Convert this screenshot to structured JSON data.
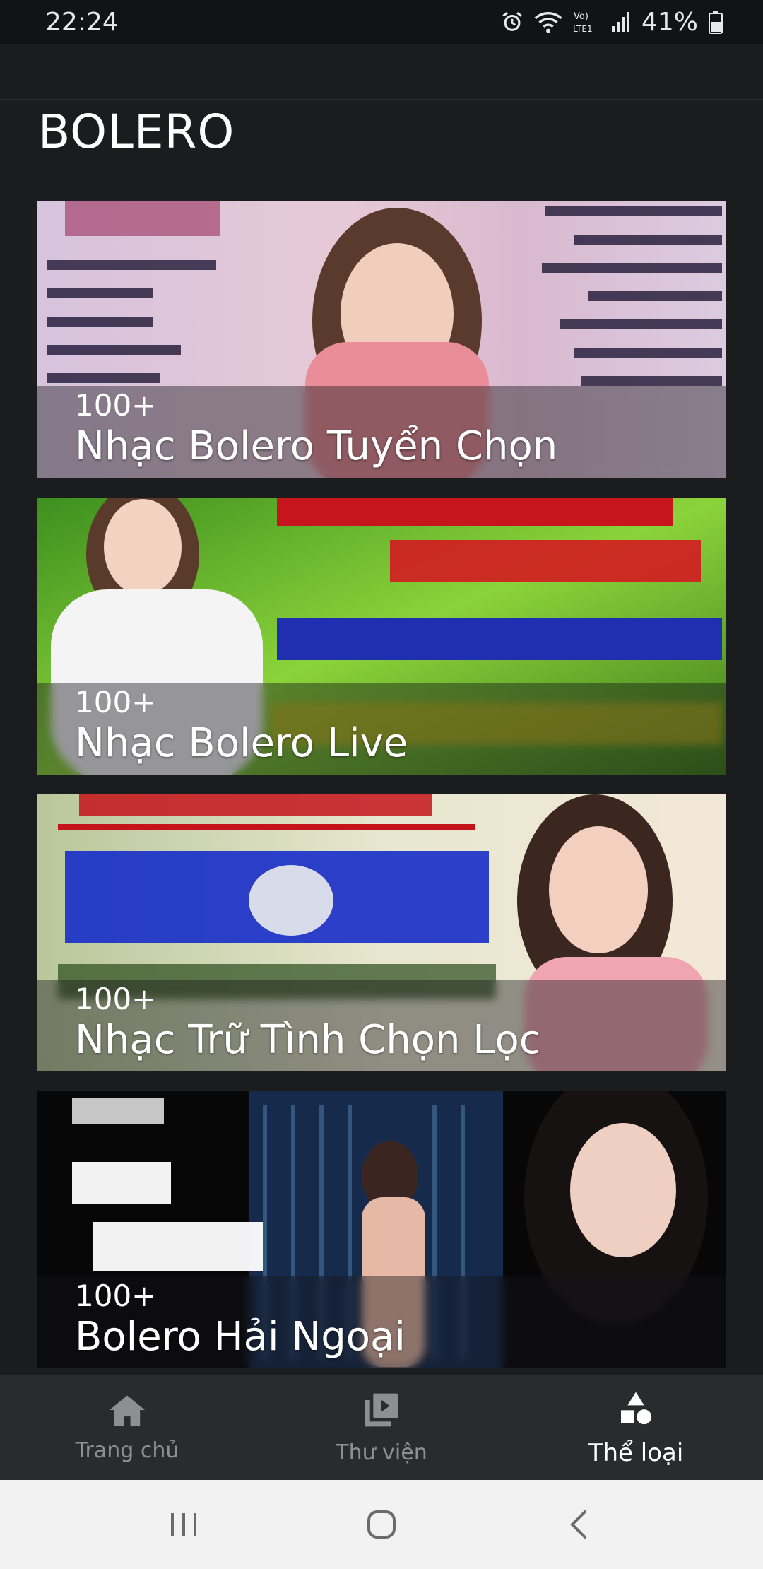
{
  "status_bar": {
    "time": "22:24",
    "battery": "41%",
    "icons": [
      "alarm-icon",
      "wifi-icon",
      "volte-icon",
      "signal-icon",
      "battery-icon"
    ]
  },
  "page": {
    "title": "BOLERO"
  },
  "cards": [
    {
      "count": "100+",
      "title": "Nhạc Bolero Tuyển Chọn"
    },
    {
      "count": "100+",
      "title": "Nhạc Bolero Live"
    },
    {
      "count": "100+",
      "title": "Nhạc Trữ Tình Chọn Lọc"
    },
    {
      "count": "100+",
      "title": "Bolero Hải Ngoại"
    }
  ],
  "bottom_nav": {
    "items": [
      {
        "label": "Trang chủ",
        "icon": "home-icon",
        "active": false
      },
      {
        "label": "Thư viện",
        "icon": "library-icon",
        "active": false
      },
      {
        "label": "Thể loại",
        "icon": "category-icon",
        "active": true
      }
    ]
  },
  "system_nav": [
    "recents-icon",
    "home-circle-icon",
    "back-icon"
  ],
  "colors": {
    "background": "#1b1c1e",
    "nav_bg": "#2a2b2d",
    "active": "#ffffff",
    "inactive": "#8e8f91"
  }
}
